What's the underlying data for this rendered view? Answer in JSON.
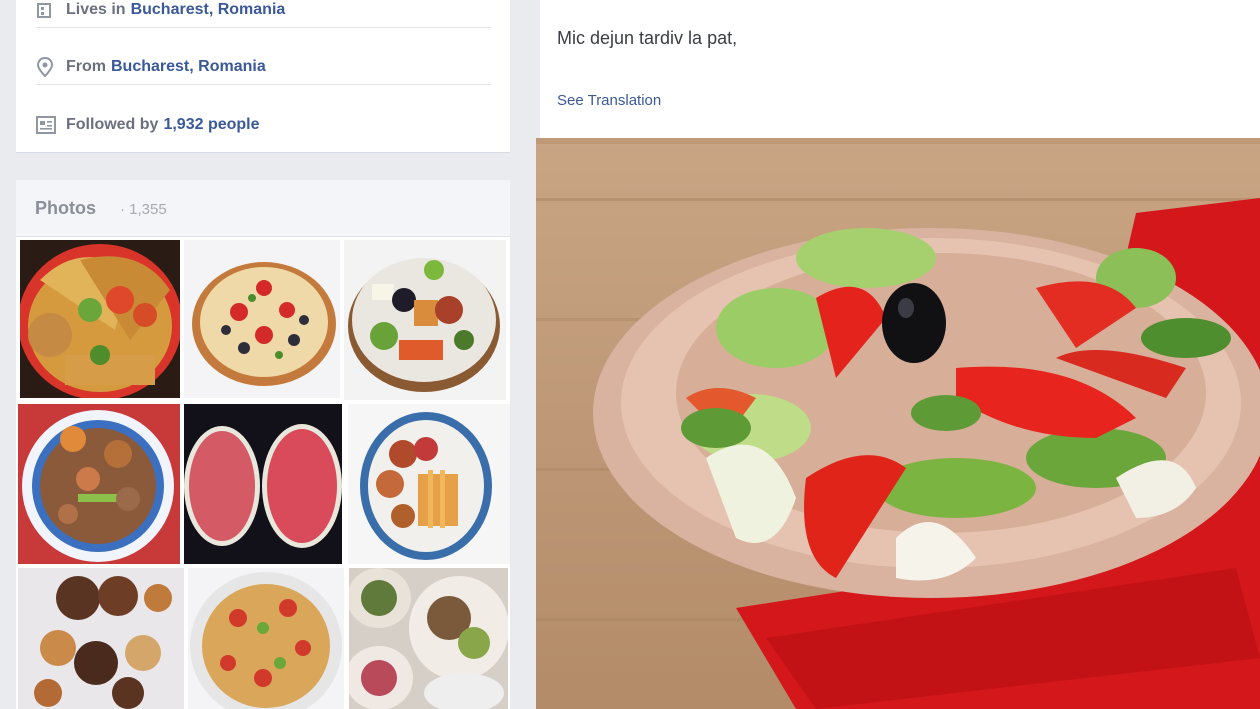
{
  "intro": {
    "lives_prefix": "Lives in",
    "lives_place": "Bucharest, Romania",
    "from_prefix": "From",
    "from_place": "Bucharest, Romania",
    "followed_prefix": "Followed by",
    "followed_count": "1,932 people"
  },
  "photos": {
    "title": "Photos",
    "count": "· 1,355",
    "thumbnails": [
      {
        "subject": "tacos"
      },
      {
        "subject": "pizza"
      },
      {
        "subject": "salad plate"
      },
      {
        "subject": "stir fry bowl"
      },
      {
        "subject": "watermelon"
      },
      {
        "subject": "fries plate"
      },
      {
        "subject": "meat platter"
      },
      {
        "subject": "spaghetti"
      },
      {
        "subject": "mixed dishes"
      }
    ]
  },
  "post": {
    "text": "Mic dejun tardiv la pat,",
    "see_translation": "See Translation",
    "photo_subject": "salad on plate"
  },
  "icons": {
    "lives": "home-icon",
    "from": "location-pin-icon",
    "followed": "followers-icon"
  },
  "colors": {
    "link": "#3b5998",
    "muted_text": "#6b7080",
    "background": "#e9ebee"
  }
}
